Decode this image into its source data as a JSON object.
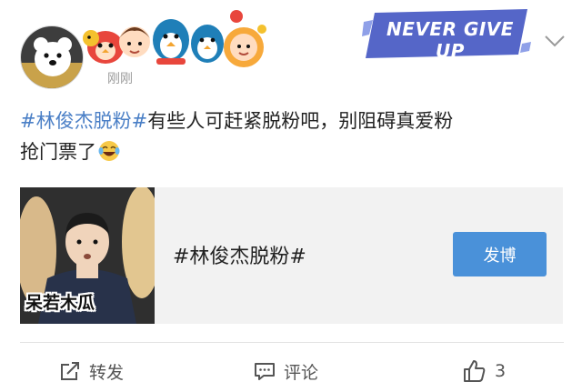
{
  "post": {
    "timestamp": "刚刚",
    "badge_text": "NEVER GIVE UP",
    "content": {
      "hashtag": "#林俊杰脱粉#",
      "text_line1": "有些人可赶紧脱粉吧，别阻碍真爱粉",
      "text_line2": "抢门票了"
    },
    "card": {
      "thumb_caption": "呆若木瓜",
      "title": "#林俊杰脱粉#",
      "button_label": "发博"
    },
    "actions": {
      "repost_label": "转发",
      "comment_label": "评论",
      "like_count": "3"
    }
  },
  "colors": {
    "hashtag": "#4a7fc6",
    "button": "#4a91d9",
    "badge": "#5566c8"
  }
}
